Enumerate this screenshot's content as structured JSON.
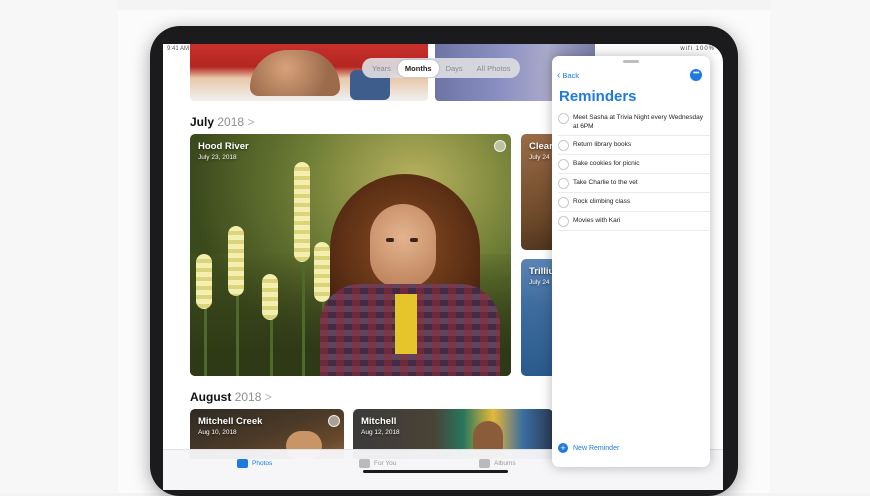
{
  "status_bar": {
    "time": "9:41 AM Jun 3",
    "indicators": "wifi 100%"
  },
  "photos": {
    "view_tabs": [
      {
        "label": "Years",
        "active": false
      },
      {
        "label": "Months",
        "active": true
      },
      {
        "label": "Days",
        "active": false
      },
      {
        "label": "All Photos",
        "active": false
      }
    ],
    "sections": [
      {
        "month": "July",
        "year": "2018",
        "chevron": ">"
      },
      {
        "month": "August",
        "year": "2018",
        "chevron": ">"
      }
    ],
    "cards": [
      {
        "title": "Hood River",
        "date": "July 23, 2018"
      },
      {
        "title": "Clear",
        "date": "July 24"
      },
      {
        "title": "Trillium",
        "date": "July 24"
      },
      {
        "title": "Mitchell Creek",
        "date": "Aug 10, 2018"
      },
      {
        "title": "Mitchell",
        "date": "Aug 12, 2018"
      }
    ],
    "tab_bar": [
      {
        "label": "Photos",
        "icon": "photos-icon",
        "active": true
      },
      {
        "label": "For You",
        "icon": "for-you-icon",
        "active": false
      },
      {
        "label": "Albums",
        "icon": "albums-icon",
        "active": false
      }
    ]
  },
  "reminders": {
    "back_label": "Back",
    "more_label": "•••",
    "title": "Reminders",
    "items": [
      {
        "text": "Meet Sasha at Trivia Night every Wednesday at 6PM"
      },
      {
        "text": "Return library books"
      },
      {
        "text": "Bake cookies for picnic"
      },
      {
        "text": "Take Charlie to the vet"
      },
      {
        "text": "Rock climbing class"
      },
      {
        "text": "Movies with Kari"
      }
    ],
    "new_reminder_label": "New Reminder"
  },
  "colors": {
    "accent": "#1f7ae0",
    "device_bezel": "#1b1b1d"
  }
}
